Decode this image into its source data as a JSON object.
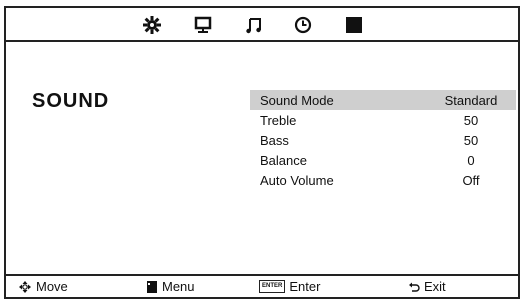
{
  "tabs": [
    {
      "name": "picture",
      "icon": "gear-icon"
    },
    {
      "name": "display",
      "icon": "monitor-icon"
    },
    {
      "name": "sound",
      "icon": "music-note-icon"
    },
    {
      "name": "time",
      "icon": "clock-icon"
    },
    {
      "name": "lock",
      "icon": "black-square-icon"
    }
  ],
  "page": {
    "title": "SOUND"
  },
  "menu": {
    "items": [
      {
        "label": "Sound Mode",
        "value": "Standard",
        "selected": true
      },
      {
        "label": "Treble",
        "value": "50"
      },
      {
        "label": "Bass",
        "value": "50"
      },
      {
        "label": "Balance",
        "value": "0"
      },
      {
        "label": "Auto Volume",
        "value": "Off"
      }
    ]
  },
  "footer": {
    "move": {
      "label": "Move",
      "icon": "dpad-icon"
    },
    "menu": {
      "label": "Menu",
      "icon": "menu-button-icon"
    },
    "enter": {
      "label": "Enter",
      "icon": "enter-key-icon",
      "key_text": "ENTER"
    },
    "exit": {
      "label": "Exit",
      "icon": "return-arrow-icon"
    }
  },
  "colors": {
    "highlight": "#cfcfcf",
    "border": "#222222",
    "background": "#ffffff"
  }
}
